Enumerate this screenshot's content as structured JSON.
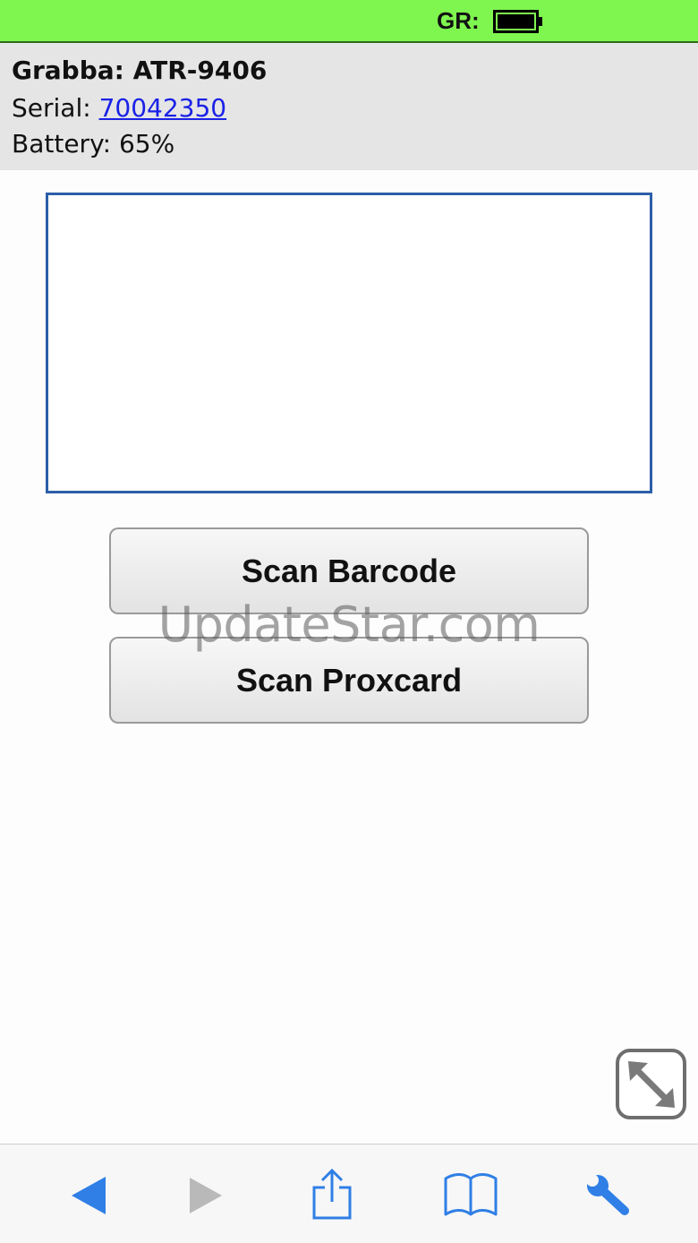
{
  "status_bar": {
    "label": "GR:",
    "background_color": "#7ff54f",
    "battery_icon": "battery-full-icon"
  },
  "device": {
    "title": "Grabba: ATR-9406",
    "serial_label": "Serial:",
    "serial_value": "70042350",
    "battery_label": "Battery:",
    "battery_value": "65%"
  },
  "scan_output": {
    "value": "",
    "border_color": "#2c5ea8"
  },
  "buttons": {
    "scan_barcode": "Scan Barcode",
    "scan_proxcard": "Scan Proxcard"
  },
  "watermark": "UpdateStar.com",
  "resize_button": {
    "icon": "expand-arrows-icon"
  },
  "toolbar": {
    "accent_color": "#2f7fe6",
    "disabled_color": "#b9b9b9",
    "items": [
      {
        "icon": "back-arrow-icon",
        "enabled": true
      },
      {
        "icon": "forward-arrow-icon",
        "enabled": false
      },
      {
        "icon": "share-icon",
        "enabled": true
      },
      {
        "icon": "bookmarks-icon",
        "enabled": true
      },
      {
        "icon": "wrench-icon",
        "enabled": true
      }
    ]
  }
}
